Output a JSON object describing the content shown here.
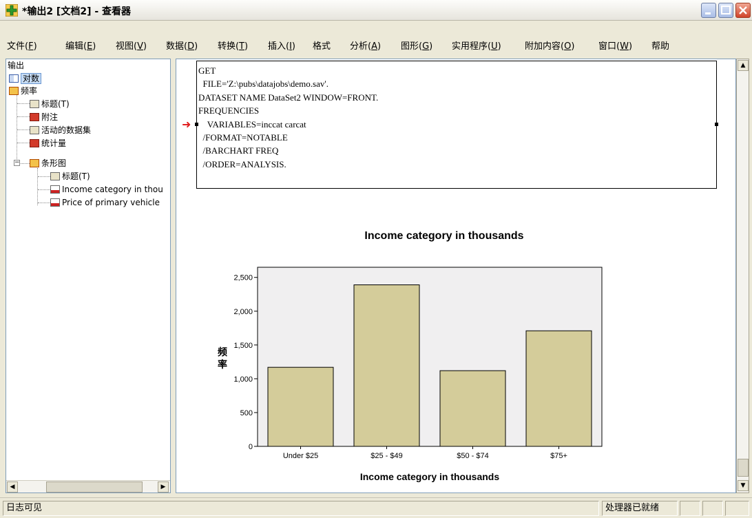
{
  "window": {
    "title": "*输出2 [文档2] - 查看器"
  },
  "menu": [
    {
      "label": "文件(",
      "key": "F",
      "tail": ")"
    },
    {
      "label": "编辑(",
      "key": "E",
      "tail": ")"
    },
    {
      "label": "视图(",
      "key": "V",
      "tail": ")"
    },
    {
      "label": "数据(",
      "key": "D",
      "tail": ")"
    },
    {
      "label": "转换(",
      "key": "T",
      "tail": ")"
    },
    {
      "label": "插入(",
      "key": "I",
      "tail": ")"
    },
    {
      "label": "格式",
      "key": "",
      "tail": ""
    },
    {
      "label": "分析(",
      "key": "A",
      "tail": ")"
    },
    {
      "label": "图形(",
      "key": "G",
      "tail": ")"
    },
    {
      "label": "实用程序(",
      "key": "U",
      "tail": ")"
    },
    {
      "label": "附加内容(",
      "key": "O",
      "tail": ")"
    },
    {
      "label": "窗口(",
      "key": "W",
      "tail": ")"
    },
    {
      "label": "帮助",
      "key": "",
      "tail": ""
    }
  ],
  "outline": {
    "root": "输出",
    "items": [
      {
        "label": "对数",
        "icon": "log-book-icon"
      },
      {
        "label": "频率",
        "icon": "frequencies-icon"
      },
      {
        "label": "标题(T)",
        "icon": "title-icon"
      },
      {
        "label": "附注",
        "icon": "notes-icon"
      },
      {
        "label": "活动的数据集",
        "icon": "dataset-icon"
      },
      {
        "label": "统计量",
        "icon": "statistics-icon"
      },
      {
        "label": "条形图",
        "icon": "bar-chart-folder-icon"
      },
      {
        "label": "标题(T)",
        "icon": "title-icon"
      },
      {
        "label": "Income category in thou",
        "icon": "chart-icon"
      },
      {
        "label": "Price of primary vehicle",
        "icon": "chart-icon"
      }
    ]
  },
  "syntax": [
    "GET",
    "  FILE='Z:\\pubs\\datajobs\\demo.sav'.",
    "DATASET NAME DataSet2 WINDOW=FRONT.",
    "FREQUENCIES",
    "    VARIABLES=inccat carcat",
    "  /FORMAT=NOTABLE",
    "  /BARCHART FREQ",
    "  /ORDER=ANALYSIS."
  ],
  "chart_data": {
    "type": "bar",
    "title": "Income category in thousands",
    "xlabel": "Income category in thousands",
    "ylabel": "频率",
    "categories": [
      "Under $25",
      "$25 - $49",
      "$50 - $74",
      "$75+"
    ],
    "values": [
      1170,
      2390,
      1120,
      1710
    ],
    "ylim": [
      0,
      2650
    ],
    "yticks": [
      0,
      500,
      1000,
      1500,
      2000,
      2500
    ],
    "ytick_labels": [
      "0",
      "500",
      "1,000",
      "1,500",
      "2,000",
      "2,500"
    ],
    "bar_color": "#d4cc9a",
    "plot_background": "#f0eff0",
    "grid": false
  },
  "status": {
    "left": "日志可见",
    "processor": "处理器已就绪"
  }
}
